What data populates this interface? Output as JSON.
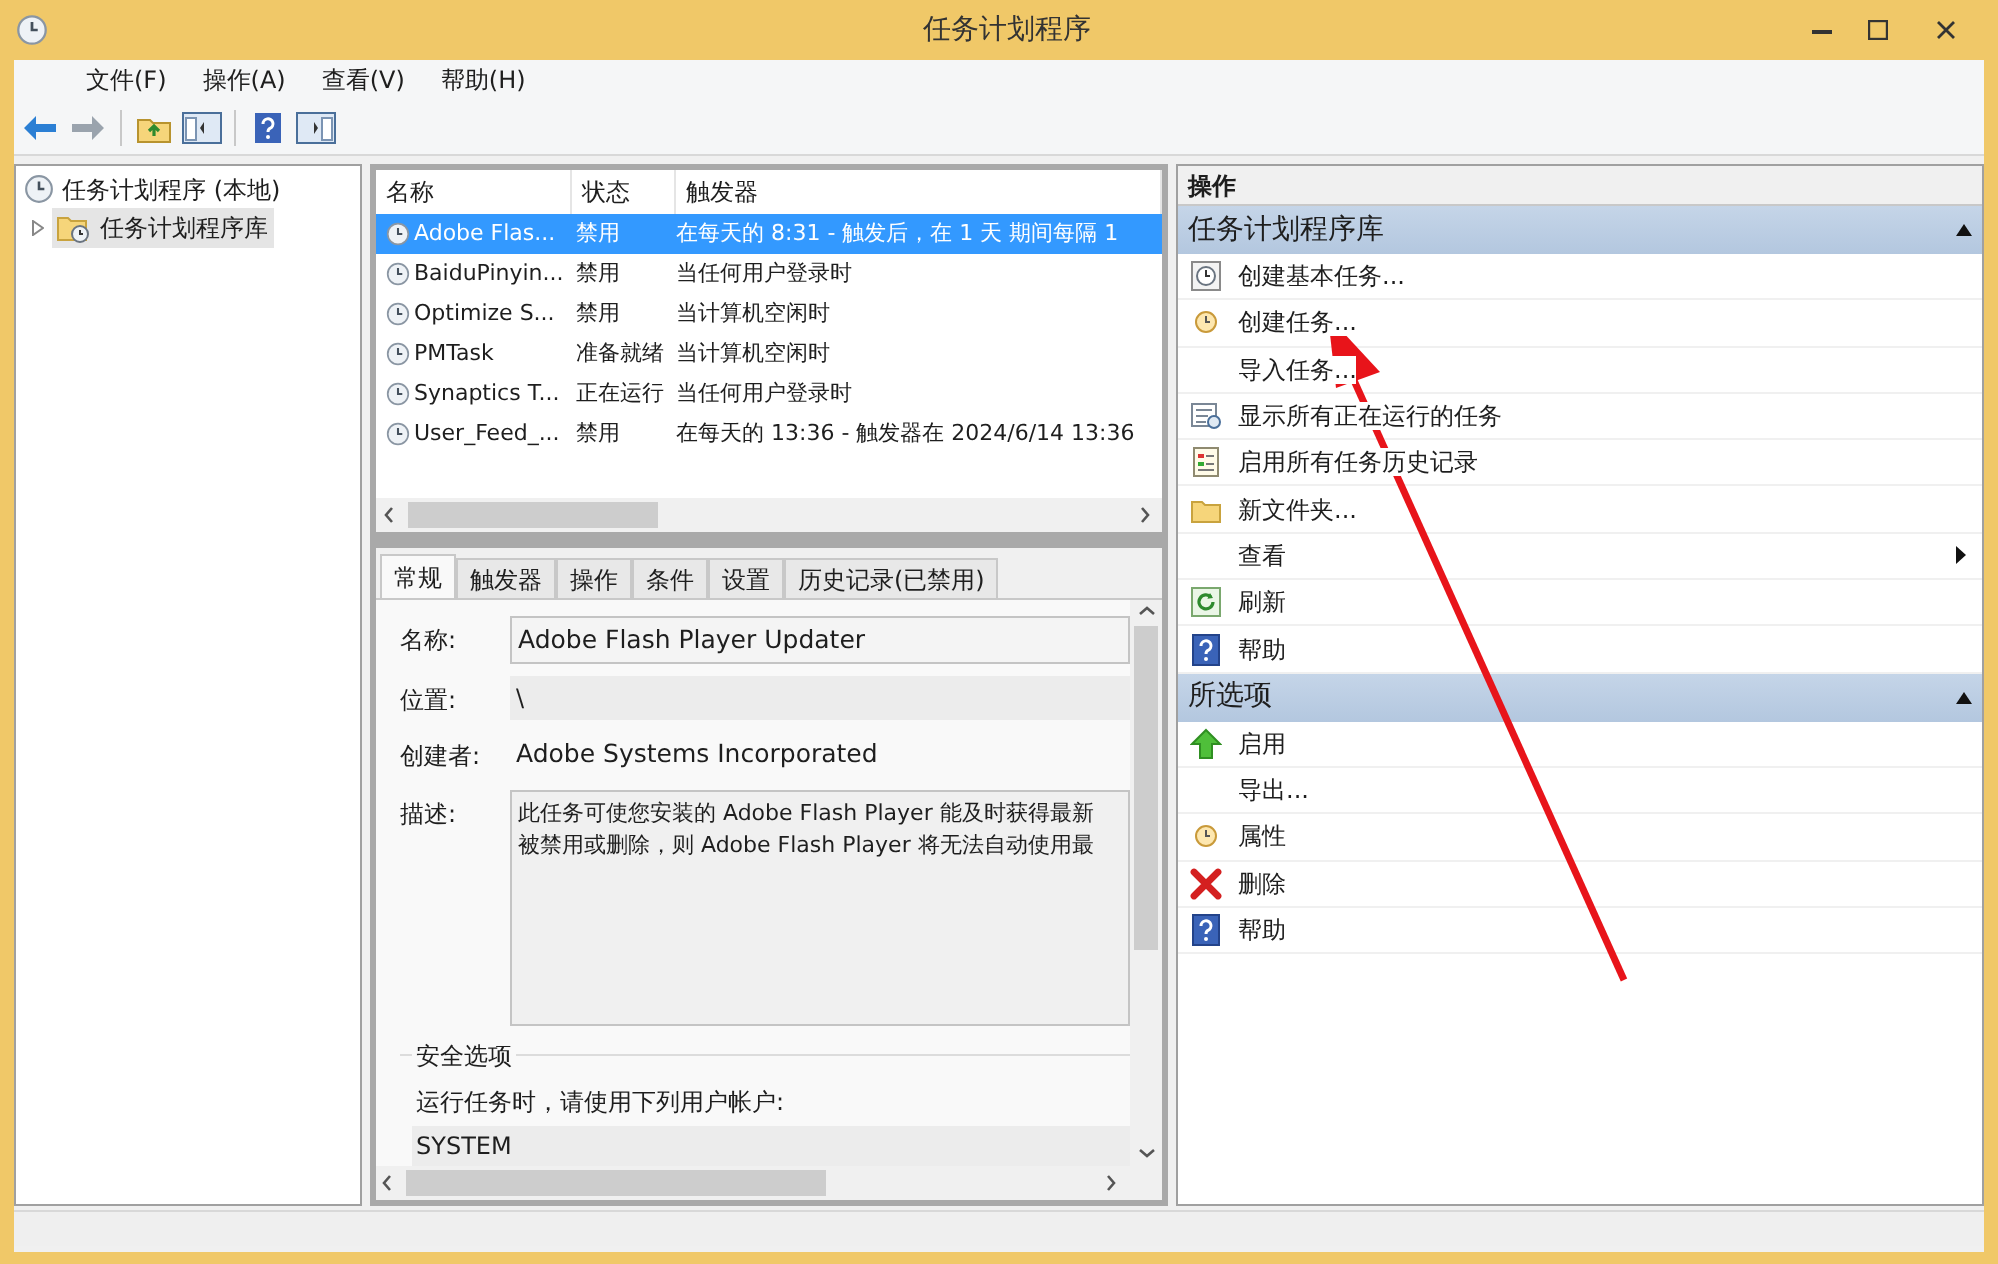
{
  "window": {
    "title": "任务计划程序"
  },
  "menu": [
    {
      "label": "文件(F)"
    },
    {
      "label": "操作(A)"
    },
    {
      "label": "查看(V)"
    },
    {
      "label": "帮助(H)"
    }
  ],
  "tree": [
    {
      "label": "任务计划程序 (本地)",
      "selected": false,
      "children": [
        {
          "label": "任务计划程序库",
          "selected": true,
          "expanded": false
        }
      ]
    }
  ],
  "tasks": {
    "columns": [
      "名称",
      "状态",
      "触发器"
    ],
    "rows": [
      {
        "name": "Adobe Flas...",
        "status": "禁用",
        "trigger": "在每天的 8:31 - 触发后，在 1 天 期间每隔 1",
        "selected": true
      },
      {
        "name": "BaiduPinyin...",
        "status": "禁用",
        "trigger": "当任何用户登录时",
        "selected": false
      },
      {
        "name": "Optimize S...",
        "status": "禁用",
        "trigger": "当计算机空闲时",
        "selected": false
      },
      {
        "name": "PMTask",
        "status": "准备就绪",
        "trigger": "当计算机空闲时",
        "selected": false
      },
      {
        "name": "Synaptics T...",
        "status": "正在运行",
        "trigger": "当任何用户登录时",
        "selected": false
      },
      {
        "name": "User_Feed_...",
        "status": "禁用",
        "trigger": "在每天的 13:36 - 触发器在 2024/6/14 13:36",
        "selected": false
      }
    ]
  },
  "detail_tabs": [
    {
      "label": "常规",
      "selected": true
    },
    {
      "label": "触发器",
      "selected": false
    },
    {
      "label": "操作",
      "selected": false
    },
    {
      "label": "条件",
      "selected": false
    },
    {
      "label": "设置",
      "selected": false
    },
    {
      "label": "历史记录(已禁用)",
      "selected": false
    }
  ],
  "general": {
    "fields": [
      {
        "kind": "input",
        "label": "名称:",
        "value": "Adobe Flash Player Updater"
      },
      {
        "kind": "shaded",
        "label": "位置:",
        "value": "\\"
      },
      {
        "kind": "text",
        "label": "创建者:",
        "value": "Adobe Systems Incorporated"
      },
      {
        "kind": "textarea",
        "label": "描述:",
        "lines": [
          "此任务可使您安装的 Adobe Flash Player 能及时获得最新",
          "被禁用或删除，则 Adobe Flash Player 将无法自动使用最"
        ]
      }
    ],
    "security": {
      "title": "安全选项",
      "prompt": "运行任务时，请使用下列用户帐户:",
      "account": "SYSTEM"
    }
  },
  "actions": {
    "title": "操作",
    "sections": [
      {
        "title": "任务计划程序库",
        "expanded": true,
        "items": [
          {
            "label": "创建基本任务...",
            "kind": "wizard"
          },
          {
            "label": "创建任务...",
            "kind": "clock"
          },
          {
            "label": "导入任务...",
            "kind": "plain"
          },
          {
            "label": "显示所有正在运行的任务",
            "kind": "list"
          },
          {
            "label": "启用所有任务历史记录",
            "kind": "log"
          },
          {
            "label": "新文件夹...",
            "kind": "folder"
          },
          {
            "label": "查看",
            "kind": "plain",
            "submenu": true
          },
          {
            "label": "刷新",
            "kind": "refresh"
          },
          {
            "label": "帮助",
            "kind": "help"
          }
        ]
      },
      {
        "title": "所选项",
        "expanded": true,
        "items": [
          {
            "label": "启用",
            "kind": "up"
          },
          {
            "label": "导出...",
            "kind": "plain"
          },
          {
            "label": "属性",
            "kind": "clock"
          },
          {
            "label": "删除",
            "kind": "delete"
          },
          {
            "label": "帮助",
            "kind": "help"
          }
        ]
      }
    ]
  }
}
